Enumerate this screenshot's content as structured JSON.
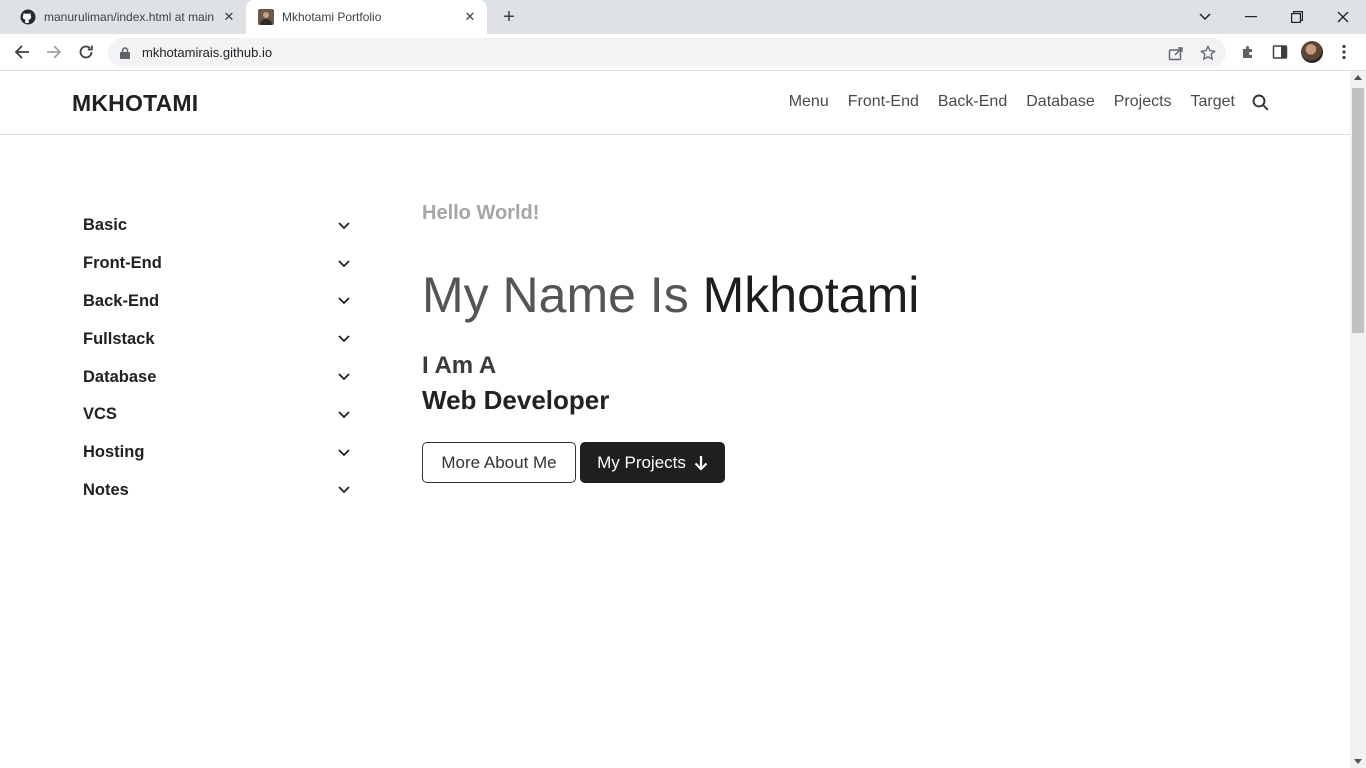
{
  "browser": {
    "tabs": [
      {
        "title": "manuruliman/index.html at main",
        "favicon": "github-icon",
        "active": false
      },
      {
        "title": "Mkhotami Portfolio",
        "favicon": "profile-photo-icon",
        "active": true
      }
    ],
    "url": "mkhotamirais.github.io"
  },
  "site": {
    "brand": "MKHOTAMI",
    "nav": [
      "Menu",
      "Front-End",
      "Back-End",
      "Database",
      "Projects",
      "Target"
    ]
  },
  "sidebar": {
    "items": [
      "Basic",
      "Front-End",
      "Back-End",
      "Fullstack",
      "Database",
      "VCS",
      "Hosting",
      "Notes"
    ]
  },
  "hero": {
    "greeting": "Hello World!",
    "name_prefix": "My Name Is",
    "name": "Mkhotami",
    "intro": "I Am A",
    "role": "Web Developer",
    "more_button": "More About Me",
    "projects_button": "My Projects"
  },
  "colors": {
    "tabstrip": "#dee1e6",
    "primary_button": "#1f1f1f",
    "greeting": "#a6a6a6"
  }
}
